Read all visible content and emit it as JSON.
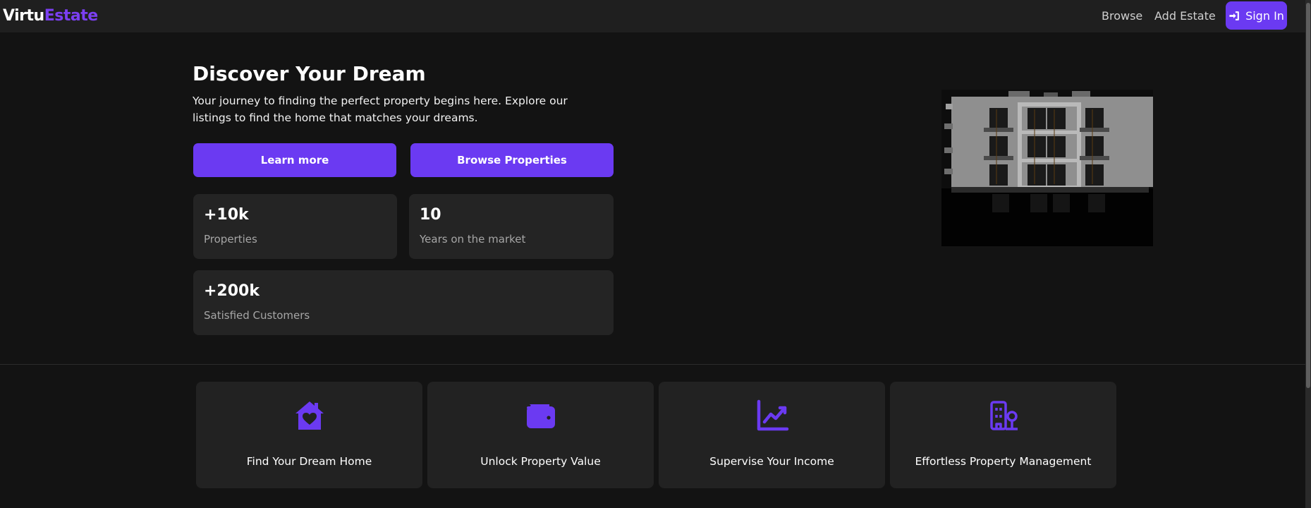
{
  "navbar": {
    "logo_part1": "Virtu",
    "logo_part2": "Estate",
    "links": [
      "Browse",
      "Add Estate"
    ],
    "signin_label": "Sign In"
  },
  "hero": {
    "title": "Discover Your Dream",
    "description": "Your journey to finding the perfect property begins here. Explore our listings to find the home that matches your dreams.",
    "learn_more_label": "Learn more",
    "browse_label": "Browse Properties"
  },
  "stats": [
    {
      "value": "+10k",
      "label": "Properties"
    },
    {
      "value": "10",
      "label": "Years on the market"
    },
    {
      "value": "+200k",
      "label": "Satisfied Customers"
    }
  ],
  "features": [
    {
      "icon": "house-heart-icon",
      "label": "Find Your Dream Home"
    },
    {
      "icon": "wallet-icon",
      "label": "Unlock Property Value"
    },
    {
      "icon": "chart-line-icon",
      "label": "Supervise Your Income"
    },
    {
      "icon": "building-icon",
      "label": "Effortless Property Management"
    }
  ],
  "colors": {
    "accent": "#6b3af2",
    "background": "#131313",
    "navbar": "#1f1f1f",
    "card": "#242424"
  }
}
